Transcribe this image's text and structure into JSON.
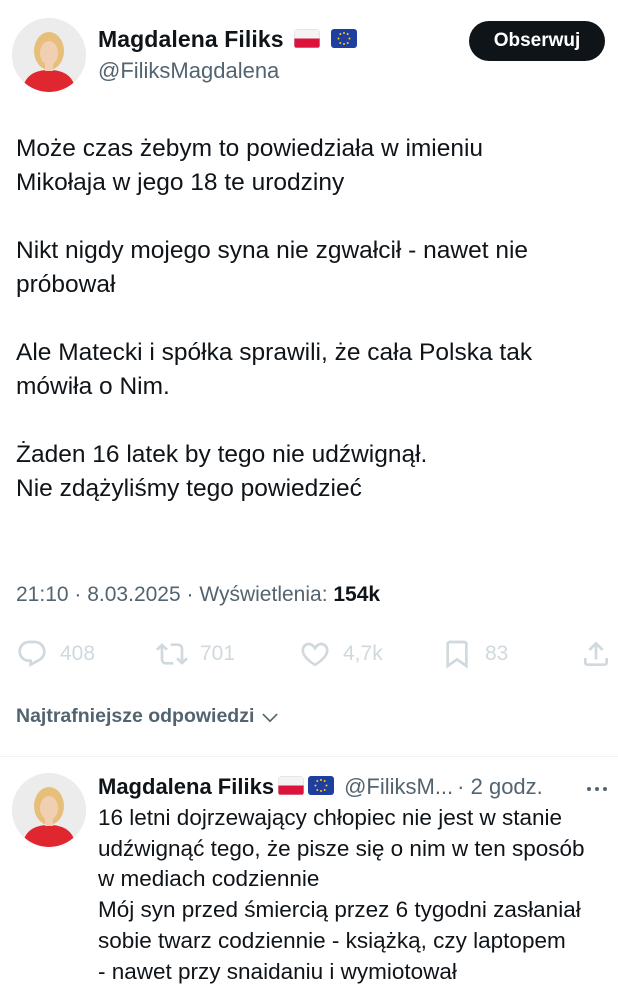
{
  "tweet": {
    "author": {
      "name": "Magdalena Filiks",
      "handle": "@FiliksMagdalena"
    },
    "follow_label": "Obserwuj",
    "paragraphs": [
      [
        "Może czas żebym to powiedziała  w imieniu",
        "Mikołaja w jego 18 te urodziny"
      ],
      [
        "Nikt nigdy mojego syna nie zgwałcił - nawet nie",
        "próbował"
      ],
      [
        "Ale Matecki i spółka sprawili, że cała Polska tak",
        "mówiła o Nim."
      ],
      [
        "Żaden 16 latek by tego nie udźwignął.",
        "Nie zdążyliśmy tego powiedzieć"
      ]
    ],
    "meta": {
      "time": "21:10",
      "date": "8.03.2025",
      "separator": " · ",
      "views_label": "Wyświetlenia:",
      "views_count": "154k"
    },
    "actions": {
      "replies": "408",
      "reposts": "701",
      "likes": "4,7k",
      "bookmarks": "83"
    },
    "icons": [
      "reply-icon",
      "retweet-icon",
      "heart-icon",
      "bookmark-icon",
      "share-icon",
      "chevron-down-icon",
      "more-icon",
      "poland-flag-icon",
      "eu-flag-icon"
    ]
  },
  "replies_sort": {
    "label": "Najtrafniejsze odpowiedzi"
  },
  "reply": {
    "author": {
      "name": "Magdalena Filiks",
      "handle_truncated": "@FiliksM...",
      "time": "· 2 godz."
    },
    "lines": [
      "16 letni dojrzewający chłopiec nie jest w stanie",
      "udźwignąć tego, że pisze się o nim w ten sposób",
      "w mediach codziennie",
      "Mój syn przed śmiercią przez 6 tygodni zasłaniał",
      "sobie twarz codziennie - książką, czy laptopem",
      "- nawet przy snaidaniu i wymiotował"
    ]
  },
  "colors": {
    "text": "#0f1419",
    "secondary": "#536471",
    "action_icons": "#cfd9de",
    "button_bg": "#0f1419",
    "button_text": "#ffffff",
    "divider": "#eff3f4"
  }
}
